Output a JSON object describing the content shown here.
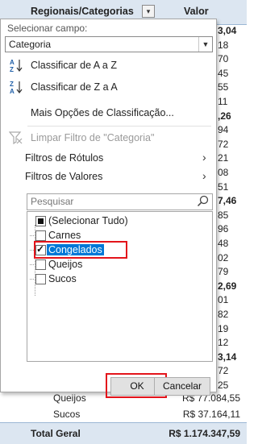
{
  "pivot": {
    "header_category": "Regionais/Categorias",
    "header_value": "Valor",
    "peek_values": [
      {
        "text": "3,04",
        "bold": true
      },
      {
        "text": "18",
        "bold": false
      },
      {
        "text": "70",
        "bold": false
      },
      {
        "text": "45",
        "bold": false
      },
      {
        "text": "55",
        "bold": false
      },
      {
        "text": "11",
        "bold": false
      },
      {
        "text": ",26",
        "bold": true
      },
      {
        "text": "94",
        "bold": false
      },
      {
        "text": "72",
        "bold": false
      },
      {
        "text": "21",
        "bold": false
      },
      {
        "text": "08",
        "bold": false
      },
      {
        "text": "51",
        "bold": false
      },
      {
        "text": "7,46",
        "bold": true
      },
      {
        "text": "85",
        "bold": false
      },
      {
        "text": "96",
        "bold": false
      },
      {
        "text": "48",
        "bold": false
      },
      {
        "text": "02",
        "bold": false
      },
      {
        "text": "79",
        "bold": false
      },
      {
        "text": "2,69",
        "bold": true
      },
      {
        "text": "01",
        "bold": false
      },
      {
        "text": "82",
        "bold": false
      },
      {
        "text": "19",
        "bold": false
      },
      {
        "text": "12",
        "bold": false
      },
      {
        "text": "3,14",
        "bold": true
      },
      {
        "text": "72",
        "bold": false
      },
      {
        "text": "25",
        "bold": false
      }
    ],
    "rows": [
      {
        "label": "Queijos",
        "value": "R$ 77.084,55"
      },
      {
        "label": "Sucos",
        "value": "R$ 37.164,11"
      }
    ],
    "total_label": "Total Geral",
    "total_value": "R$ 1.174.347,59"
  },
  "panel": {
    "select_field_label": "Selecionar campo:",
    "field_value": "Categoria",
    "sort_az": "Classificar de A a Z",
    "sort_za": "Classificar de Z a A",
    "more_sort": "Mais Opções de Classificação...",
    "clear_filter": "Limpar Filtro de \"Categoria\"",
    "label_filters": "Filtros de Rótulos",
    "value_filters": "Filtros de Valores",
    "search_placeholder": "Pesquisar",
    "items": [
      {
        "label": "(Selecionar Tudo)",
        "state": "partial"
      },
      {
        "label": "Carnes",
        "state": "unchecked"
      },
      {
        "label": "Congelados",
        "state": "checked"
      },
      {
        "label": "Queijos",
        "state": "unchecked"
      },
      {
        "label": "Sucos",
        "state": "unchecked"
      }
    ],
    "ok_label": "OK",
    "cancel_label": "Cancelar"
  },
  "colors": {
    "highlight": "#0078d7",
    "annotation": "#e3141b",
    "header_bg": "#dce6f1"
  }
}
